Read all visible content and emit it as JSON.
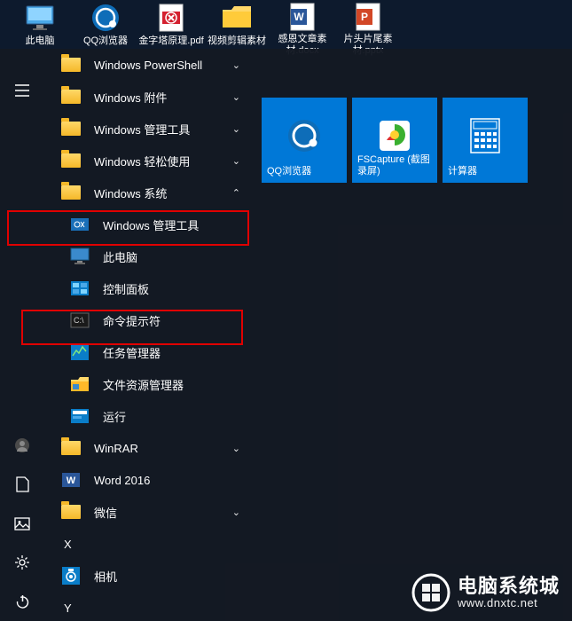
{
  "desktop_icons": [
    {
      "label": "此电脑"
    },
    {
      "label": "QQ浏览器"
    },
    {
      "label": "金字塔原理.pdf"
    },
    {
      "label": "视频剪辑素材"
    },
    {
      "label": "感恩文章素材.docx"
    },
    {
      "label": "片头片尾素材.pptx"
    }
  ],
  "apps": {
    "powershell": "Windows PowerShell",
    "accessories": "Windows 附件",
    "admintools": "Windows 管理工具",
    "ease": "Windows 轻松使用",
    "system": "Windows 系统",
    "admintools2": "Windows 管理工具",
    "thispc": "此电脑",
    "control": "控制面板",
    "cmd": "命令提示符",
    "taskmgr": "任务管理器",
    "explorer": "文件资源管理器",
    "run": "运行",
    "winrar": "WinRAR",
    "word": "Word 2016",
    "wechat": "微信",
    "camera": "相机"
  },
  "letters": {
    "x": "X",
    "y": "Y"
  },
  "tiles": {
    "qq": "QQ浏览器",
    "fsc": "FSCapture (截图录屏)",
    "calc": "计算器"
  },
  "watermark": {
    "title": "电脑系统城",
    "url": "www.dnxtc.net"
  }
}
